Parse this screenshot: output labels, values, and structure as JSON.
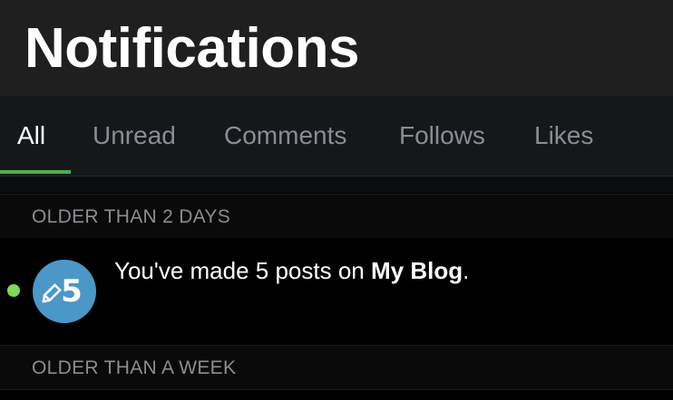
{
  "header": {
    "title": "Notifications"
  },
  "tabs": [
    {
      "label": "All",
      "active": true
    },
    {
      "label": "Unread",
      "active": false
    },
    {
      "label": "Comments",
      "active": false
    },
    {
      "label": "Follows",
      "active": false
    },
    {
      "label": "Likes",
      "active": false
    }
  ],
  "sections": [
    {
      "label": "OLDER THAN 2 DAYS",
      "items": [
        {
          "unread": true,
          "badge": {
            "icon": "pencil-icon",
            "number": "5"
          },
          "text_before": "You've made 5 posts on ",
          "text_bold": "My Blog",
          "text_after": "."
        }
      ]
    },
    {
      "label": "OLDER THAN A WEEK",
      "items": []
    }
  ],
  "colors": {
    "accent": "#4caf50",
    "unread_dot": "#7ed957",
    "badge": "#4a98c8",
    "header_bg": "#1f1f20",
    "tabbar_bg": "#15181b",
    "muted_text": "#8a8d91"
  }
}
